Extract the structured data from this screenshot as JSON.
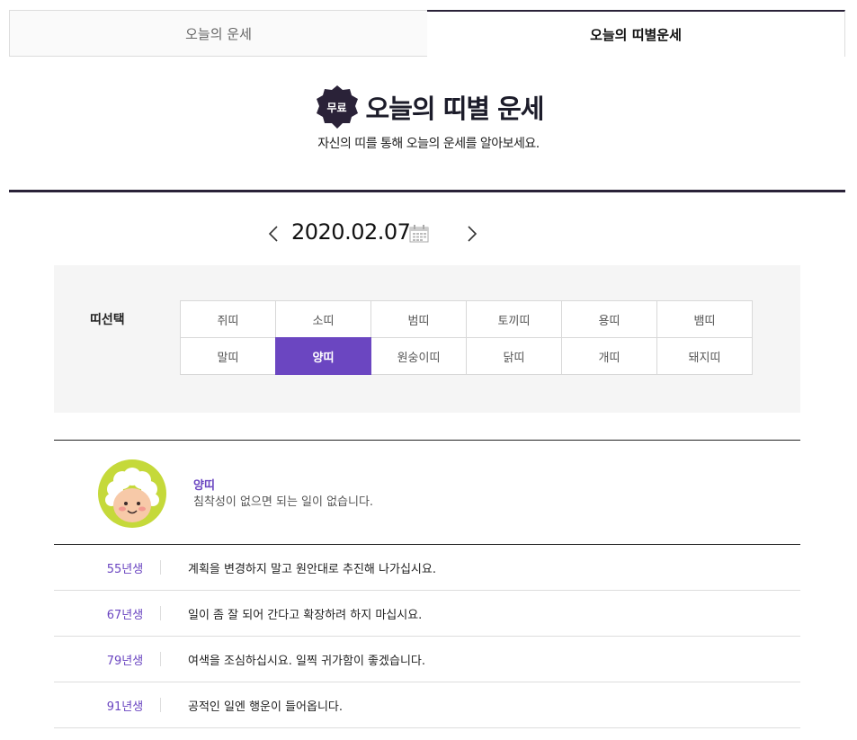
{
  "tabs": [
    {
      "label": "오늘의 운세",
      "active": false
    },
    {
      "label": "오늘의 띠별운세",
      "active": true
    }
  ],
  "header": {
    "badge": "무료",
    "title": "오늘의 띠별 운세",
    "subtitle": "자신의 띠를 통해 오늘의 운세를 알아보세요."
  },
  "date_nav": {
    "date": "2020.02.07",
    "prev_icon": "chevron-left-icon",
    "next_icon": "chevron-right-icon",
    "calendar_icon": "calendar-icon"
  },
  "zodiac": {
    "label": "띠선택",
    "selected": "양띠",
    "items": [
      "쥐띠",
      "소띠",
      "범띠",
      "토끼띠",
      "용띠",
      "뱀띠",
      "말띠",
      "양띠",
      "원숭이띠",
      "닭띠",
      "개띠",
      "돼지띠"
    ]
  },
  "result": {
    "name": "양띠",
    "description": "침착성이 없으면 되는 일이 없습니다.",
    "years": [
      {
        "year": "55년생",
        "text": "계획을 변경하지 말고 원안대로 추진해 나가십시요."
      },
      {
        "year": "67년생",
        "text": "일이 좀 잘 되어 간다고 확장하려 하지 마십시요."
      },
      {
        "year": "79년생",
        "text": "여색을 조심하십시요. 일찍 귀가함이 좋겠습니다."
      },
      {
        "year": "91년생",
        "text": "공적인 일엔 행운이 들어옵니다."
      }
    ]
  },
  "colors": {
    "accent": "#6b46c1",
    "dark": "#2a2238"
  }
}
